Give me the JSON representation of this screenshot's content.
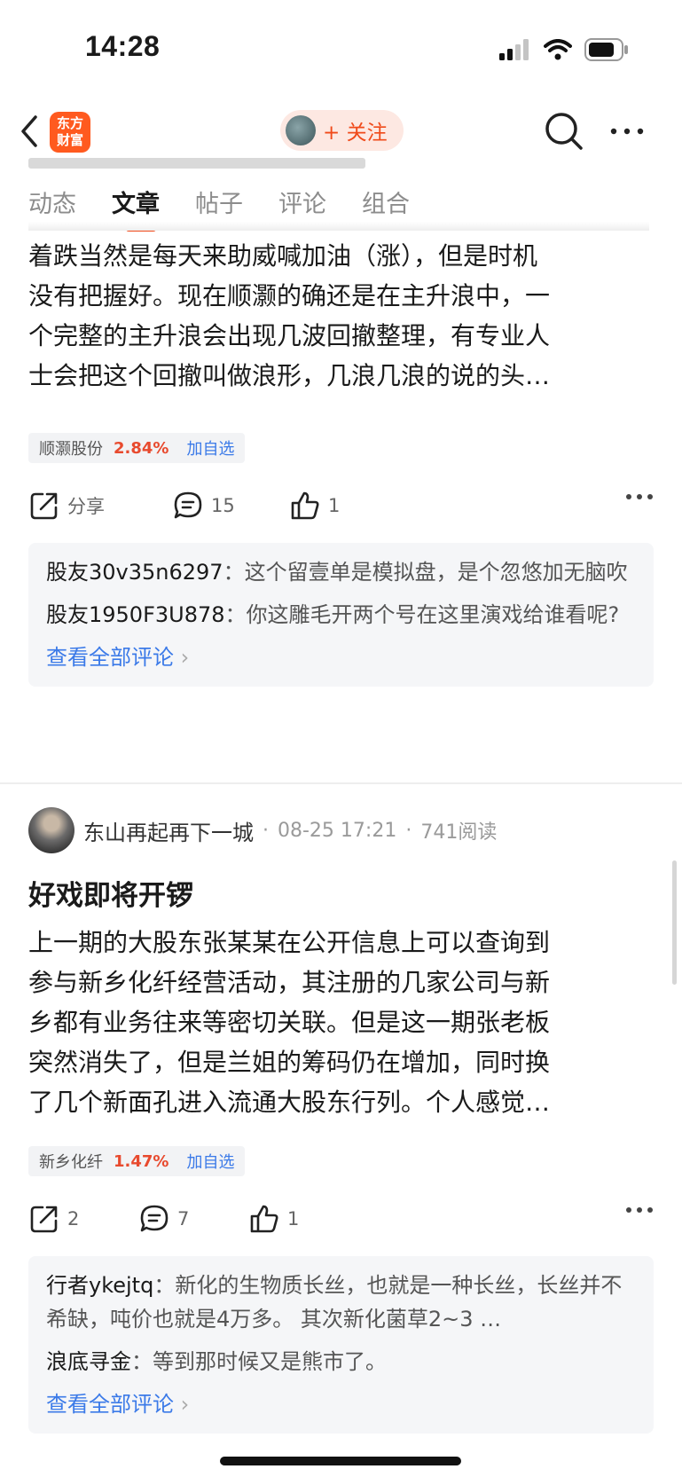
{
  "status_bar": {
    "time": "14:28"
  },
  "nav": {
    "logo_text_1": "东方",
    "logo_text_2": "财富",
    "follow_label": "+ 关注"
  },
  "tabs": [
    "动态",
    "文章",
    "帖子",
    "评论",
    "组合"
  ],
  "active_tab": "文章",
  "post1": {
    "body_lines": [
      "着跌当然是每天来助威喊加油（涨），但是时机",
      "没有把握好。现在顺灏的确还是在主升浪中，一",
      "个完整的主升浪会出现几波回撤整理，有专业人",
      "士会把这个回撤叫做浪形，几浪几浪的说的头…"
    ],
    "stock": {
      "name": "顺灏股份",
      "change": "2.84%",
      "add_label": "加自选"
    },
    "actions": {
      "share_label": "分享",
      "comment_count": "15",
      "like_count": "1"
    },
    "comments": [
      {
        "user": "股友30v35n6297",
        "text": "这个留壹单是模拟盘，是个忽悠加无脑吹"
      },
      {
        "user": "股友1950F3U878",
        "text": "你这雕毛开两个号在这里演戏给谁看呢?"
      }
    ],
    "see_all": "查看全部评论"
  },
  "post2": {
    "author": "东山再起再下一城",
    "time": "08-25 17:21",
    "reads": "741阅读",
    "title": "好戏即将开锣",
    "body_lines": [
      "上一期的大股东张某某在公开信息上可以查询到",
      "参与新乡化纤经营活动，其注册的几家公司与新",
      "乡都有业务往来等密切关联。但是这一期张老板",
      "突然消失了，但是兰姐的筹码仍在增加，同时换",
      "了几个新面孔进入流通大股东行列。个人感觉…"
    ],
    "stock": {
      "name": "新乡化纤",
      "change": "1.47%",
      "add_label": "加自选"
    },
    "actions": {
      "share_count": "2",
      "comment_count": "7",
      "like_count": "1"
    },
    "comments": [
      {
        "user": "行者ykejtq",
        "text": "新化的生物质长丝，也就是一种长丝，长丝并不希缺，吨价也就是4万多。  其次新化菌草2~3 …"
      },
      {
        "user": "浪底寻金",
        "text": "等到那时候又是熊市了。"
      }
    ],
    "see_all": "查看全部评论"
  }
}
